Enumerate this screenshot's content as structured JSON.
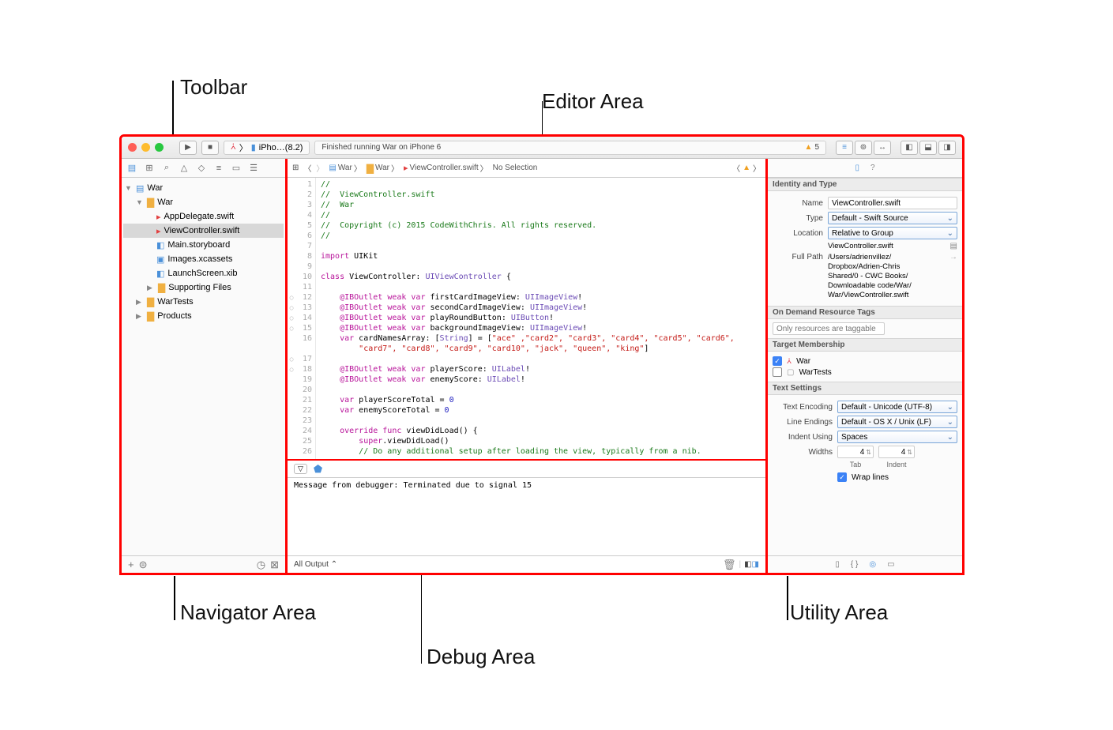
{
  "annotations": {
    "toolbar": "Toolbar",
    "editor": "Editor Area",
    "navigator": "Navigator Area",
    "debug": "Debug Area",
    "utility": "Utility Area"
  },
  "toolbar": {
    "scheme_app": "iPho…(8.2)",
    "status_text": "Finished running War on iPhone 6",
    "warning_count": "5"
  },
  "navigator": {
    "root": "War",
    "group": "War",
    "files": {
      "appdelegate": "AppDelegate.swift",
      "viewcontroller": "ViewController.swift",
      "storyboard": "Main.storyboard",
      "xcassets": "Images.xcassets",
      "launchscreen": "LaunchScreen.xib",
      "supporting": "Supporting Files"
    },
    "wartests": "WarTests",
    "products": "Products"
  },
  "jumpbar": {
    "project": "War",
    "group": "War",
    "file": "ViewController.swift",
    "selection": "No Selection"
  },
  "code": {
    "l1": "//",
    "l2": "//  ViewController.swift",
    "l3": "//  War",
    "l4": "//",
    "l5": "//  Copyright (c) 2015 CodeWithChris. All rights reserved.",
    "l6": "//",
    "l8a": "import",
    "l8b": " UIKit",
    "l10a": "class",
    "l10b": " ViewController: ",
    "l10c": "UIViewController",
    "l10d": " {",
    "ib": "@IBOutlet",
    "wv": "weak var",
    "l12b": " firstCardImageView: ",
    "l12c": "UIImageView",
    "l12d": "!",
    "l13b": " secondCardImageView: ",
    "l14b": " playRoundButton: ",
    "l14c": "UIButton",
    "l15b": " backgroundImageView: ",
    "l16a": "var",
    "l16b": " cardNamesArray: [",
    "l16c": "String",
    "l16d": "] = [",
    "l16e": "\"ace\" ,\"card2\", \"card3\", \"card4\", \"card5\", \"card6\",",
    "l16f": "\"card7\", \"card8\", \"card9\", \"card10\", \"jack\", \"queen\", \"king\"",
    "l16g": "]",
    "l18b": " playerScore: ",
    "l18c": "UILabel",
    "l19b": " enemyScore: ",
    "l21b": " playerScoreTotal = ",
    "l22b": " enemyScoreTotal = ",
    "zero": "0",
    "l24a": "override func",
    "l24b": " viewDidLoad() {",
    "l25a": "super",
    "l25b": ".viewDidLoad()",
    "l26": "// Do any additional setup after loading the view, typically from a nib."
  },
  "debug": {
    "message": "Message from debugger: Terminated due to signal 15",
    "filter": "All Output"
  },
  "utility": {
    "identity_header": "Identity and Type",
    "name_label": "Name",
    "name_value": "ViewController.swift",
    "type_label": "Type",
    "type_value": "Default - Swift Source",
    "location_label": "Location",
    "location_value": "Relative to Group",
    "location_file": "ViewController.swift",
    "fullpath_label": "Full Path",
    "fullpath_value": "/Users/adrienvillez/\nDropbox/Adrien-Chris\nShared/0 - CWC Books/\nDownloadable code/War/\nWar/ViewController.swift",
    "odr_header": "On Demand Resource Tags",
    "odr_placeholder": "Only resources are taggable",
    "target_header": "Target Membership",
    "target_war": "War",
    "target_wartests": "WarTests",
    "text_header": "Text Settings",
    "encoding_label": "Text Encoding",
    "encoding_value": "Default - Unicode (UTF-8)",
    "lineend_label": "Line Endings",
    "lineend_value": "Default - OS X / Unix (LF)",
    "indent_label": "Indent Using",
    "indent_value": "Spaces",
    "widths_label": "Widths",
    "tab_value": "4",
    "indent_w_value": "4",
    "tab_sub": "Tab",
    "indent_sub": "Indent",
    "wrap_label": "Wrap lines"
  }
}
